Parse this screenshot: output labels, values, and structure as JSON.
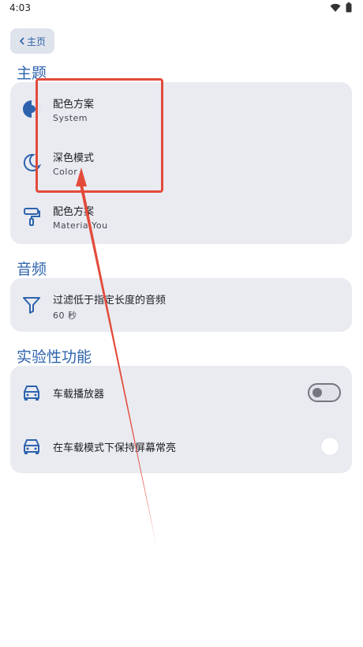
{
  "status": {
    "time": "4:03"
  },
  "nav": {
    "back_label": "主页"
  },
  "sections": {
    "theme": {
      "title": "主题",
      "items": [
        {
          "title": "配色方案",
          "subtitle": "System"
        },
        {
          "title": "深色模式",
          "subtitle": "Color"
        },
        {
          "title": "配色方案",
          "subtitle": "Materia You"
        }
      ]
    },
    "audio": {
      "title": "音频",
      "items": [
        {
          "title": "过滤低于指定长度的音频",
          "subtitle": "60 秒"
        }
      ]
    },
    "experimental": {
      "title": "实验性功能",
      "items": [
        {
          "title": "车载播放器",
          "toggle": "off"
        },
        {
          "title": "在车载模式下保持屏幕常亮",
          "toggle": "off"
        }
      ]
    }
  },
  "colors": {
    "accent": "#2d63ad",
    "card": "#e9ebf1",
    "annotation": "#e34a3a"
  }
}
